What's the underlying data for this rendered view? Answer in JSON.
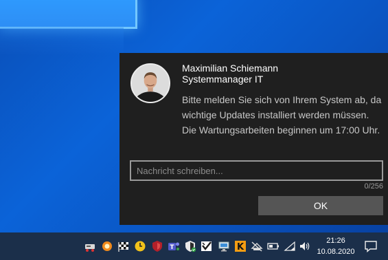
{
  "toast": {
    "sender_name": "Maximilian Schiemann",
    "sender_role": "Systemmanager IT",
    "message": "Bitte melden Sie sich von Ihrem System ab, da wichtige Updates installiert werden müssen. Die Wartungsarbeiten beginnen um 17:00 Uhr.",
    "reply_placeholder": "Nachricht schreiben...",
    "char_count": "0/256",
    "ok_label": "OK"
  },
  "taskbar": {
    "time": "21:26",
    "date": "10.08.2020",
    "tray_icons": [
      "network-drive-icon",
      "sun-icon",
      "checkered-flag-icon",
      "clock-app-icon",
      "shield-red-icon",
      "teams-icon",
      "defender-shield-icon",
      "checkmark-app-icon",
      "remote-desktop-icon",
      "k-app-icon",
      "no-network-icon",
      "battery-icon",
      "wifi-icon",
      "speaker-icon"
    ]
  },
  "colors": {
    "toast_bg": "#1f1f1f",
    "ok_button_bg": "#555555",
    "taskbar_bg": "#1b2f4a",
    "desktop_bg": "#0b63d8"
  }
}
